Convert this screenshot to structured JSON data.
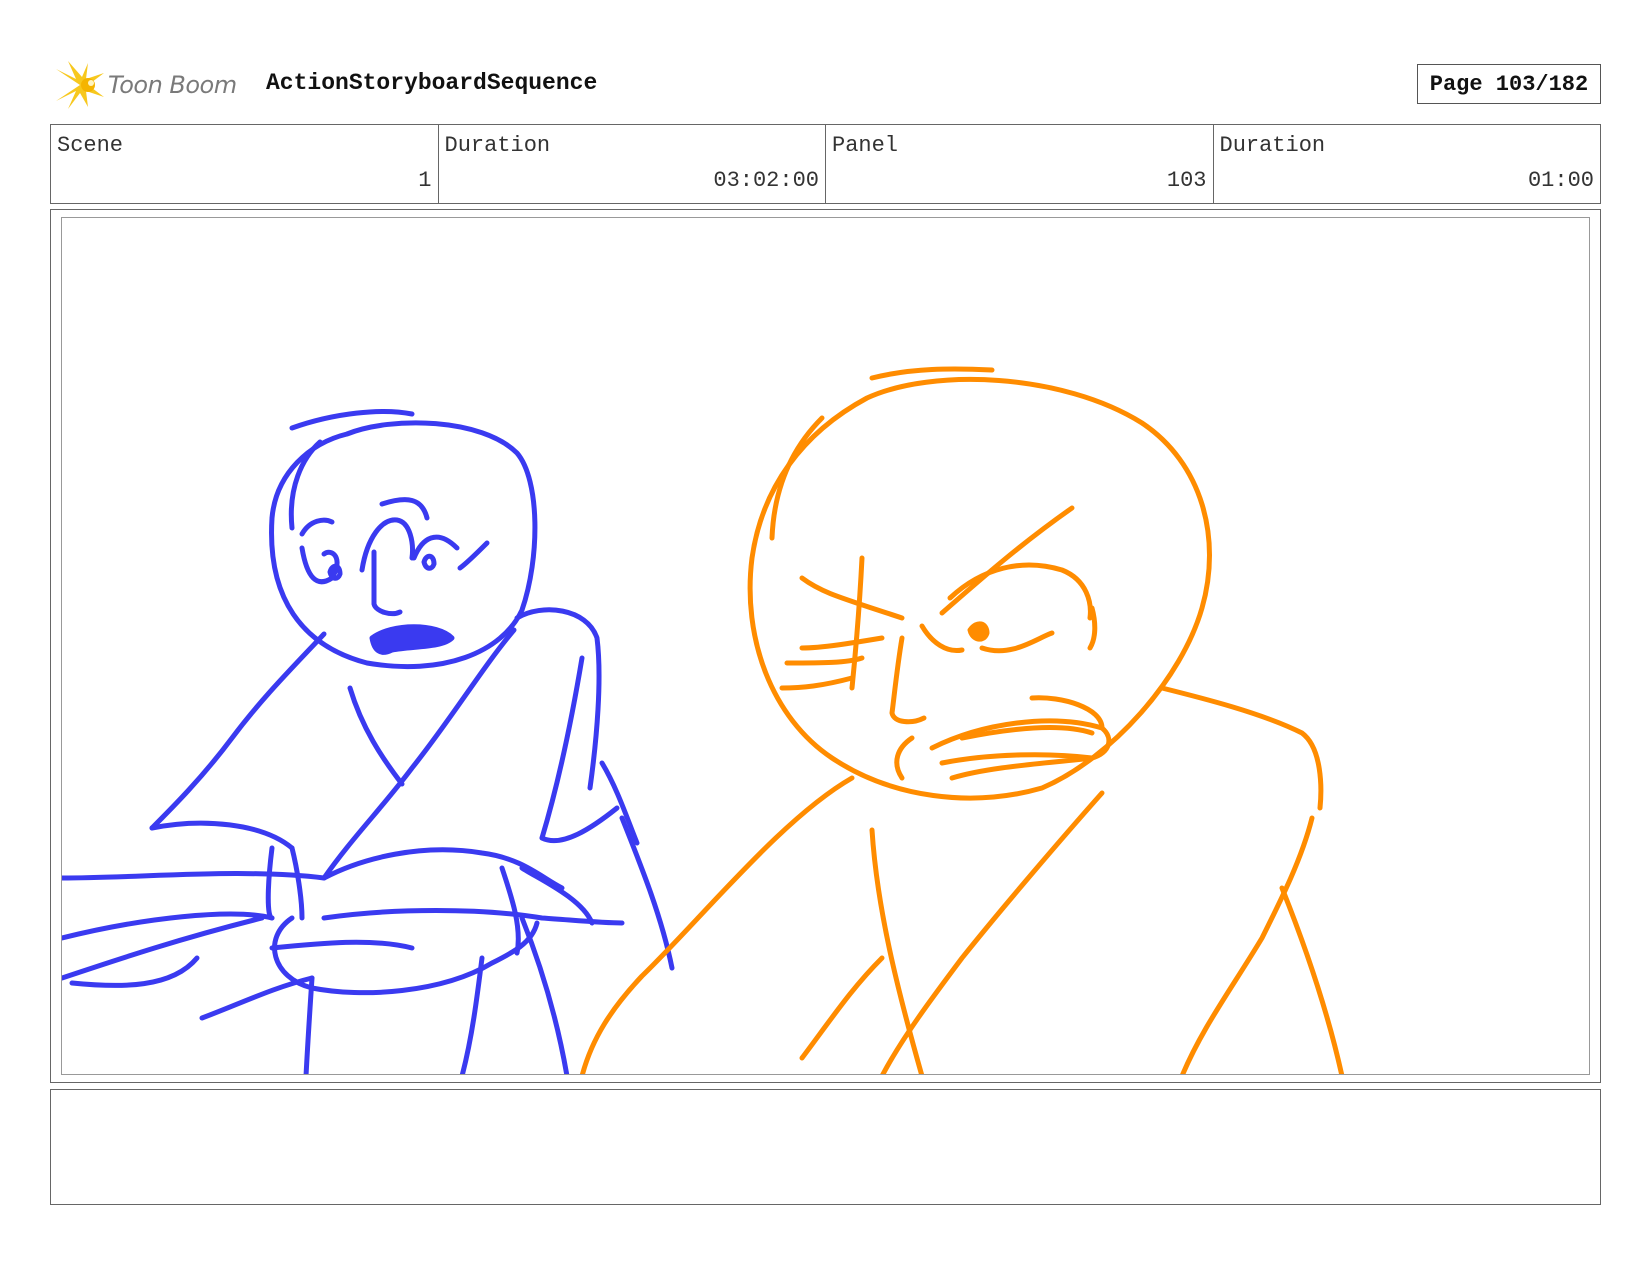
{
  "header": {
    "logo_text": "Toon Boom",
    "project_title": "ActionStoryboardSequence",
    "page_label": "Page 103/182"
  },
  "info": {
    "scene_label": "Scene",
    "scene_value": "1",
    "scene_duration_label": "Duration",
    "scene_duration_value": "03:02:00",
    "panel_label": "Panel",
    "panel_value": "103",
    "panel_duration_label": "Duration",
    "panel_duration_value": "01:00"
  },
  "sketch": {
    "left_character_color": "#3a3af0",
    "right_character_color": "#ff8c00"
  },
  "notes": {
    "text": ""
  }
}
